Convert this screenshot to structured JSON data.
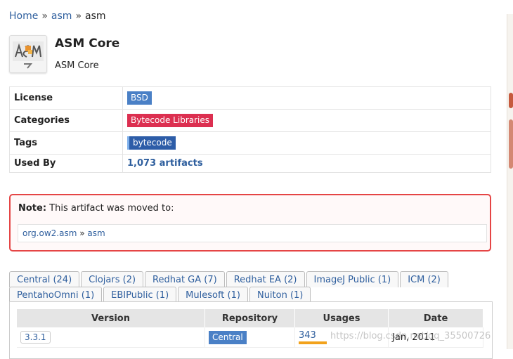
{
  "breadcrumb": {
    "home": "Home",
    "sep": "»",
    "group": "asm",
    "current": "asm"
  },
  "artifact": {
    "title": "ASM Core",
    "subtitle": "ASM Core"
  },
  "info": {
    "license_label": "License",
    "license_value": "BSD",
    "categories_label": "Categories",
    "categories_value": "Bytecode Libraries",
    "tags_label": "Tags",
    "tags_value": "bytecode",
    "usedby_label": "Used By",
    "usedby_value": "1,073 artifacts"
  },
  "note": {
    "label": "Note:",
    "text": " This artifact was moved to:",
    "group": "org.ow2.asm",
    "sep": "»",
    "artifact": "asm"
  },
  "tabs_row1": [
    "Central (24)",
    "Clojars (2)",
    "Redhat GA (7)",
    "Redhat EA (2)",
    "ImageJ Public (1)",
    "ICM (2)"
  ],
  "tabs_row2": [
    "PentahoOmni (1)",
    "EBIPublic (1)",
    "Mulesoft (1)",
    "Nuiton (1)"
  ],
  "versions_table": {
    "headers": [
      "Version",
      "Repository",
      "Usages",
      "Date"
    ],
    "rows": [
      {
        "version": "3.3.1",
        "repository": "Central",
        "usages": "343",
        "usages_fraction": 0.2,
        "date": "Jan, 2011"
      }
    ]
  },
  "watermark": "https://blog.csdn.net/qq_35500726",
  "colors": {
    "link": "#2f5f9e",
    "license_badge": "#4a80c6",
    "category_badge": "#dc2f50",
    "tag_badge": "#2d5da8",
    "note_border": "#e54545",
    "usage_bar": "#f2a21b"
  }
}
